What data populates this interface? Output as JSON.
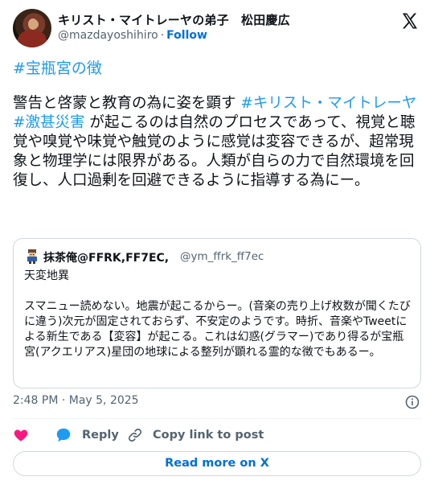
{
  "author": {
    "display_name": "キリスト・マイトレーヤの弟子　松田慶広",
    "handle": "@mazdayoshihiro",
    "separator": "·",
    "follow_label": "Follow"
  },
  "tweet": {
    "hashtag_line": "#宝瓶宮の徴",
    "body": {
      "part1": "警告と啓蒙と教育の為に姿を顕す ",
      "tag1": "#キリスト・マイトレーヤ",
      "tag2": "#激甚災害",
      "part2": " が起こるのは自然のプロセスであって、視覚と聴覚や嗅覚や味覚や触覚のように感覚は変容できるが、超常現象と物理学には限界がある。人類が自らの力で自然環境を回復し、人口過剰を回避できるように指導する為にー。"
    }
  },
  "quote": {
    "name": "抹茶俺@FFRK,FF7EC,",
    "handle": "@ym_ffrk_ff7ec",
    "text": "天変地異\n\nスマニュー読めない。地震が起こるからー。(音楽の売り上げ枚数が聞くたびに違う)次元が固定されておらず、不安定のようです。時折、音楽やTweetによる新生である【変容】が起こる。これは幻惑(グラマー)であり得るが宝瓶宮(アクエリアス)星団の地球による整列が顕れる霊的な徴でもあるー。"
  },
  "meta": {
    "timestamp": "2:48 PM · May 5, 2025"
  },
  "actions": {
    "reply_label": "Reply",
    "copy_label": "Copy link to post",
    "read_more_label": "Read more on X"
  },
  "colors": {
    "link": "#1d9bf0",
    "follow": "#006fd6",
    "like": "#f91880",
    "secondary_text": "#536471"
  },
  "icons": [
    "x-logo-icon",
    "heart-icon",
    "reply-bubble-icon",
    "link-icon",
    "info-icon"
  ]
}
